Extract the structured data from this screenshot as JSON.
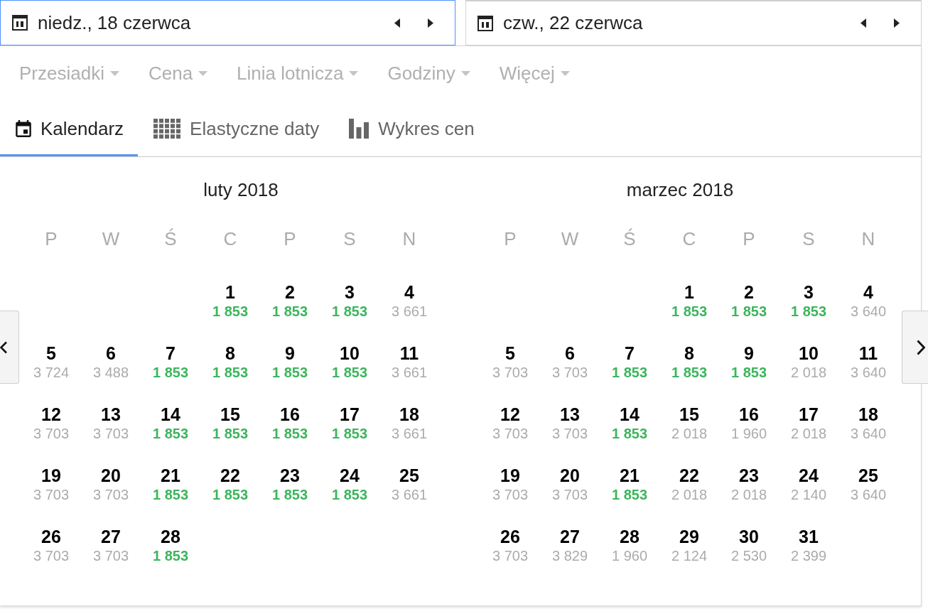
{
  "date_fields": [
    {
      "value": "niedz., 18 czerwca",
      "focused": true
    },
    {
      "value": "czw., 22 czerwca",
      "focused": false
    }
  ],
  "filters": [
    "Przesiadki",
    "Cena",
    "Linia lotnicza",
    "Godziny",
    "Więcej"
  ],
  "view_tabs": [
    {
      "label": "Kalendarz",
      "kind": "calendar",
      "selected": true
    },
    {
      "label": "Elastyczne daty",
      "kind": "grid",
      "selected": false
    },
    {
      "label": "Wykres cen",
      "kind": "chart",
      "selected": false
    }
  ],
  "months": [
    {
      "title": "luty 2018",
      "weekdays": [
        "P",
        "W",
        "Ś",
        "C",
        "P",
        "S",
        "N"
      ],
      "weeks": [
        [
          {
            "day": "1",
            "price": "1 853",
            "lowest": true
          },
          {
            "day": "2",
            "price": "1 853",
            "lowest": true
          },
          {
            "day": "3",
            "price": "1 853",
            "lowest": true
          },
          {
            "day": "4",
            "price": "3 661",
            "lowest": false
          }
        ],
        [
          {
            "day": "5",
            "price": "3 724",
            "lowest": false
          },
          {
            "day": "6",
            "price": "3 488",
            "lowest": false
          },
          {
            "day": "7",
            "price": "1 853",
            "lowest": true
          },
          {
            "day": "8",
            "price": "1 853",
            "lowest": true
          },
          {
            "day": "9",
            "price": "1 853",
            "lowest": true
          },
          {
            "day": "10",
            "price": "1 853",
            "lowest": true
          },
          {
            "day": "11",
            "price": "3 661",
            "lowest": false
          }
        ],
        [
          {
            "day": "12",
            "price": "3 703",
            "lowest": false
          },
          {
            "day": "13",
            "price": "3 703",
            "lowest": false
          },
          {
            "day": "14",
            "price": "1 853",
            "lowest": true
          },
          {
            "day": "15",
            "price": "1 853",
            "lowest": true
          },
          {
            "day": "16",
            "price": "1 853",
            "lowest": true
          },
          {
            "day": "17",
            "price": "1 853",
            "lowest": true
          },
          {
            "day": "18",
            "price": "3 661",
            "lowest": false
          }
        ],
        [
          {
            "day": "19",
            "price": "3 703",
            "lowest": false
          },
          {
            "day": "20",
            "price": "3 703",
            "lowest": false
          },
          {
            "day": "21",
            "price": "1 853",
            "lowest": true
          },
          {
            "day": "22",
            "price": "1 853",
            "lowest": true
          },
          {
            "day": "23",
            "price": "1 853",
            "lowest": true
          },
          {
            "day": "24",
            "price": "1 853",
            "lowest": true
          },
          {
            "day": "25",
            "price": "3 661",
            "lowest": false
          }
        ],
        [
          {
            "day": "26",
            "price": "3 703",
            "lowest": false
          },
          {
            "day": "27",
            "price": "3 703",
            "lowest": false
          },
          {
            "day": "28",
            "price": "1 853",
            "lowest": true
          }
        ]
      ]
    },
    {
      "title": "marzec 2018",
      "weekdays": [
        "P",
        "W",
        "Ś",
        "C",
        "P",
        "S",
        "N"
      ],
      "weeks": [
        [
          {
            "day": "1",
            "price": "1 853",
            "lowest": true
          },
          {
            "day": "2",
            "price": "1 853",
            "lowest": true
          },
          {
            "day": "3",
            "price": "1 853",
            "lowest": true
          },
          {
            "day": "4",
            "price": "3 640",
            "lowest": false
          }
        ],
        [
          {
            "day": "5",
            "price": "3 703",
            "lowest": false
          },
          {
            "day": "6",
            "price": "3 703",
            "lowest": false
          },
          {
            "day": "7",
            "price": "1 853",
            "lowest": true
          },
          {
            "day": "8",
            "price": "1 853",
            "lowest": true
          },
          {
            "day": "9",
            "price": "1 853",
            "lowest": true
          },
          {
            "day": "10",
            "price": "2 018",
            "lowest": false
          },
          {
            "day": "11",
            "price": "3 640",
            "lowest": false
          }
        ],
        [
          {
            "day": "12",
            "price": "3 703",
            "lowest": false
          },
          {
            "day": "13",
            "price": "3 703",
            "lowest": false
          },
          {
            "day": "14",
            "price": "1 853",
            "lowest": true
          },
          {
            "day": "15",
            "price": "2 018",
            "lowest": false
          },
          {
            "day": "16",
            "price": "1 960",
            "lowest": false
          },
          {
            "day": "17",
            "price": "2 018",
            "lowest": false
          },
          {
            "day": "18",
            "price": "3 640",
            "lowest": false
          }
        ],
        [
          {
            "day": "19",
            "price": "3 703",
            "lowest": false
          },
          {
            "day": "20",
            "price": "3 703",
            "lowest": false
          },
          {
            "day": "21",
            "price": "1 853",
            "lowest": true
          },
          {
            "day": "22",
            "price": "2 018",
            "lowest": false
          },
          {
            "day": "23",
            "price": "2 018",
            "lowest": false
          },
          {
            "day": "24",
            "price": "2 140",
            "lowest": false
          },
          {
            "day": "25",
            "price": "3 640",
            "lowest": false
          }
        ],
        [
          {
            "day": "26",
            "price": "3 703",
            "lowest": false
          },
          {
            "day": "27",
            "price": "3 829",
            "lowest": false
          },
          {
            "day": "28",
            "price": "1 960",
            "lowest": false
          },
          {
            "day": "29",
            "price": "2 124",
            "lowest": false
          },
          {
            "day": "30",
            "price": "2 530",
            "lowest": false
          },
          {
            "day": "31",
            "price": "2 399",
            "lowest": false
          }
        ]
      ]
    }
  ]
}
